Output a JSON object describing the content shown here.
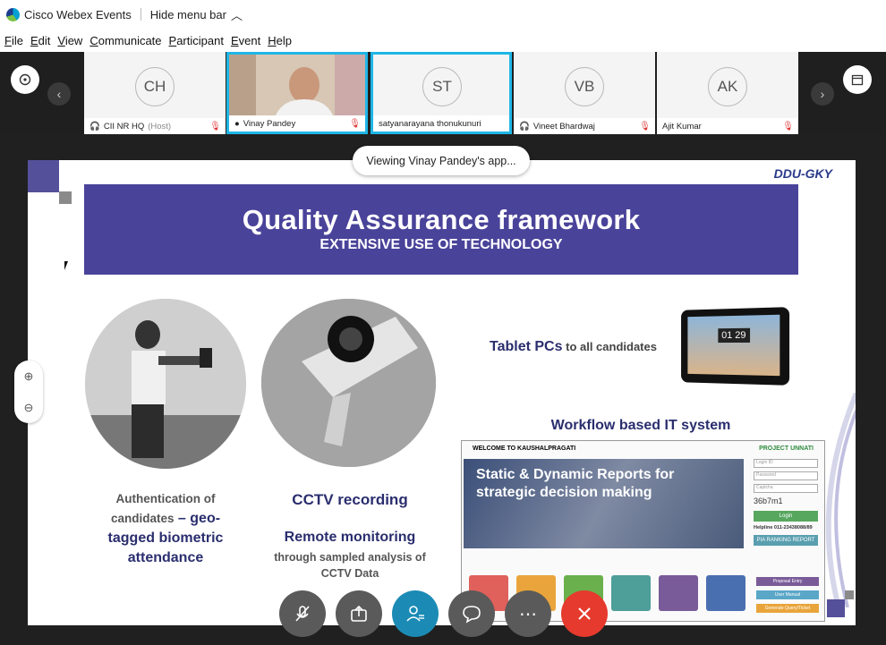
{
  "window": {
    "app_title": "Cisco Webex Events",
    "hide_menu_label": "Hide menu bar"
  },
  "menu": [
    "File",
    "Edit",
    "View",
    "Communicate",
    "Participant",
    "Event",
    "Help"
  ],
  "participants": [
    {
      "initials": "CH",
      "name": "CII NR HQ",
      "role": "(Host)"
    },
    {
      "initials": "",
      "name": "Vinay Pandey",
      "role": ""
    },
    {
      "initials": "ST",
      "name": "satyanarayana thonukunuri",
      "role": ""
    },
    {
      "initials": "VB",
      "name": "Vineet Bhardwaj",
      "role": ""
    },
    {
      "initials": "AK",
      "name": "Ajit Kumar",
      "role": ""
    }
  ],
  "share": {
    "viewing_text": "Viewing Vinay Pandey's app..."
  },
  "slide": {
    "brand": "DDU-GKY",
    "title": "Quality Assurance framework",
    "subtitle": "EXTENSIVE USE OF TECHNOLOGY",
    "auth_caption_a": "Authentication of candidates",
    "auth_caption_b": " – geo-tagged biometric attendance",
    "cctv_title": "CCTV recording",
    "remote_title": "Remote monitoring",
    "remote_sub": "through sampled analysis of CCTV Data",
    "tablet_bold": "Tablet PCs",
    "tablet_rest": " to all candidates",
    "tablet_clock": "01 29",
    "workflow_title": "Workflow based IT system",
    "ws_welcome": "WELCOME TO KAUSHALPRAGATI",
    "ws_project": "PROJECT UNNATI",
    "ws_hero": "Static & Dynamic Reports for strategic decision making",
    "ws_login_id": "Login ID",
    "ws_password": "Password",
    "ws_captcha": "Captcha",
    "ws_captcha_code": "36b7m1",
    "ws_login_btn": "Login",
    "ws_helpline": "Helpline 011-23438088/89",
    "ws_pia": "PIA RANKING REPORT",
    "ws_side": [
      "Proposal Entry",
      "User Manual",
      "Generate Query/Ticket"
    ]
  },
  "colors": {
    "accent": "#4a439a",
    "active_tile": "#1fb6e6",
    "end_call": "#e53a2d"
  }
}
